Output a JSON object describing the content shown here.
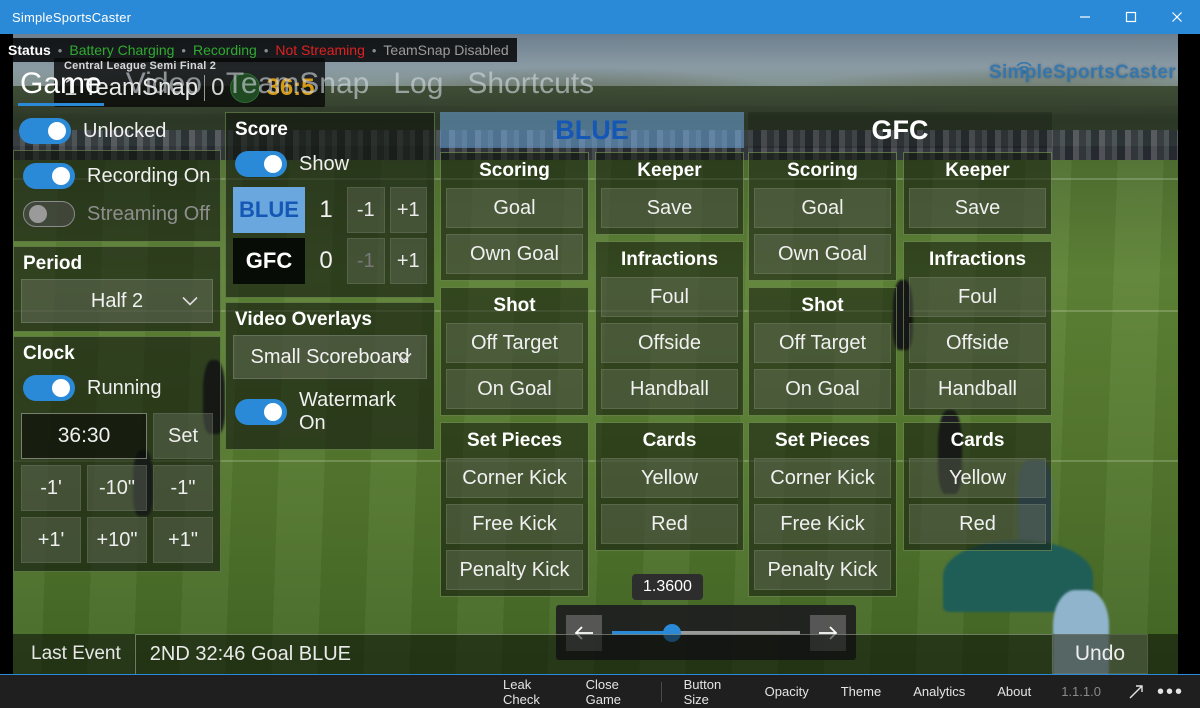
{
  "window": {
    "title": "SimpleSportsCaster",
    "minimize_label": "minimize",
    "maximize_label": "maximize",
    "close_label": "close"
  },
  "status": {
    "label": "Status",
    "separator": "•",
    "items": [
      {
        "text": "Battery Charging",
        "state": "ok"
      },
      {
        "text": "Recording",
        "state": "ok"
      },
      {
        "text": "Not Streaming",
        "state": "alert"
      },
      {
        "text": "TeamSnap Disabled",
        "state": "muted"
      }
    ]
  },
  "video_overlay": {
    "competition": "Central League Semi Final 2",
    "home_score": "1",
    "home_team": "TeamSnap",
    "away_score": "0",
    "clock": "36:5"
  },
  "watermark": {
    "text": "SimpleSportsCaster"
  },
  "tabs": [
    {
      "label": "Game",
      "active": true
    },
    {
      "label": "Video",
      "active": false
    },
    {
      "label": "TeamSnap",
      "active": false
    },
    {
      "label": "Log",
      "active": false
    },
    {
      "label": "Shortcuts",
      "active": false
    }
  ],
  "controls": {
    "lock": {
      "label": "Unlocked",
      "on": true
    },
    "recording": {
      "label": "Recording On",
      "on": true
    },
    "streaming": {
      "label": "Streaming Off",
      "on": false
    },
    "period": {
      "title": "Period",
      "value": "Half 2",
      "chevron": "chevron-down-icon"
    },
    "clock": {
      "title": "Clock",
      "running_label": "Running",
      "running_on": true,
      "time": "36:30",
      "set_label": "Set",
      "adjust": [
        "-1'",
        "-10\"",
        "-1\"",
        "+1'",
        "+10\"",
        "+1\""
      ]
    }
  },
  "score": {
    "title": "Score",
    "show_label": "Show",
    "show_on": true,
    "rows": [
      {
        "team": "BLUE",
        "value": "1",
        "dec": "-1",
        "inc": "+1",
        "dec_enabled": true
      },
      {
        "team": "GFC",
        "value": "0",
        "dec": "-1",
        "inc": "+1",
        "dec_enabled": false
      }
    ]
  },
  "overlays": {
    "title": "Video Overlays",
    "selected": "Small Scoreboard",
    "chevron": "chevron-down-icon",
    "watermark_label": "Watermark On",
    "watermark_on": true
  },
  "teams": [
    {
      "name": "BLUE",
      "style": "blue",
      "left_categories": [
        {
          "title": "Scoring",
          "buttons": [
            "Goal",
            "Own Goal"
          ]
        },
        {
          "title": "Shot",
          "buttons": [
            "Off Target",
            "On Goal"
          ]
        },
        {
          "title": "Set Pieces",
          "buttons": [
            "Corner Kick",
            "Free Kick",
            "Penalty Kick"
          ]
        }
      ],
      "right_categories": [
        {
          "title": "Keeper",
          "buttons": [
            "Save"
          ]
        },
        {
          "title": "Infractions",
          "buttons": [
            "Foul",
            "Offside",
            "Handball"
          ]
        },
        {
          "title": "Cards",
          "buttons": [
            "Yellow",
            "Red"
          ]
        }
      ]
    },
    {
      "name": "GFC",
      "style": "dark",
      "left_categories": [
        {
          "title": "Scoring",
          "buttons": [
            "Goal",
            "Own Goal"
          ]
        },
        {
          "title": "Shot",
          "buttons": [
            "Off Target",
            "On Goal"
          ]
        },
        {
          "title": "Set Pieces",
          "buttons": [
            "Corner Kick",
            "Free Kick",
            "Penalty Kick"
          ]
        }
      ],
      "right_categories": [
        {
          "title": "Keeper",
          "buttons": [
            "Save"
          ]
        },
        {
          "title": "Infractions",
          "buttons": [
            "Foul",
            "Offside",
            "Handball"
          ]
        },
        {
          "title": "Cards",
          "buttons": [
            "Yellow",
            "Red"
          ]
        }
      ]
    }
  ],
  "slider": {
    "tooltip": "1.3600",
    "value_percent": 32,
    "prev_label": "previous",
    "next_label": "next"
  },
  "last_event": {
    "label": "Last Event",
    "value": "2ND 32:46 Goal BLUE",
    "undo_label": "Undo"
  },
  "command_bar": {
    "items": [
      "Leak Check",
      "Close Game",
      "Button Size",
      "Opacity",
      "Theme",
      "Analytics",
      "About"
    ],
    "version": "1.1.1.0",
    "expand_icon": "expand-arrow-icon",
    "more_icon": "more-options-icon"
  },
  "colors": {
    "accent": "#2b8ad8",
    "status_ok": "#2faa2f",
    "status_alert": "#e02020",
    "status_muted": "#9b9b9b",
    "clock_amber": "#d79a15",
    "team_blue": "#1457b4"
  }
}
